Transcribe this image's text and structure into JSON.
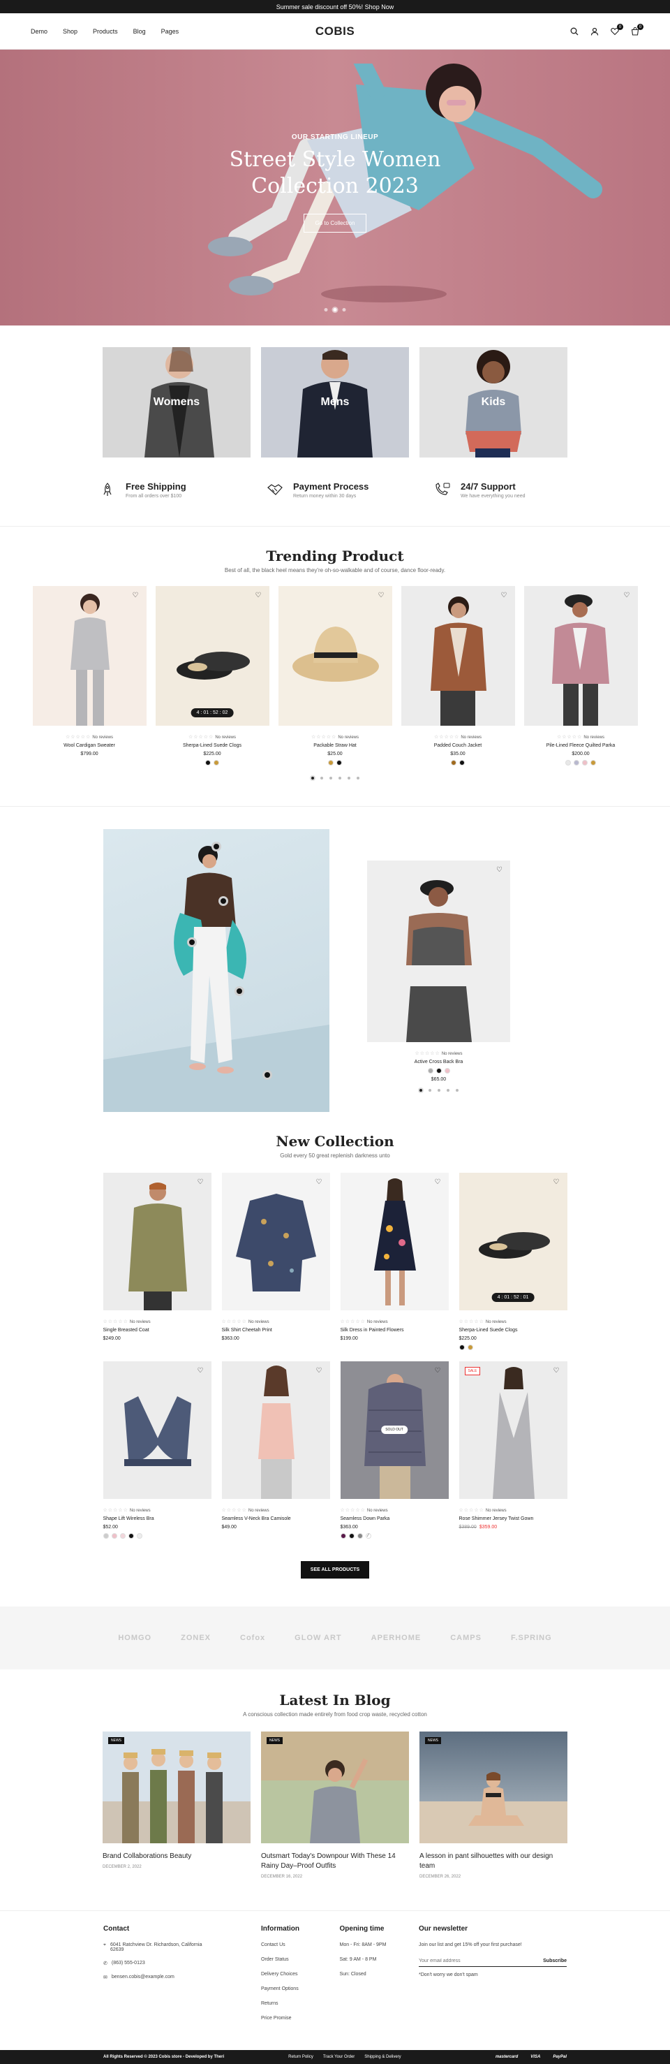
{
  "topbar": {
    "text": "Summer sale discount off 50%! Shop Now"
  },
  "header": {
    "nav": [
      "Demo",
      "Shop",
      "Products",
      "Blog",
      "Pages"
    ],
    "logo": "COBIS",
    "wishlist_count": "0",
    "cart_count": "0"
  },
  "hero": {
    "subtitle": "OUR STARTING LINEUP",
    "title_line1": "Street Style Women",
    "title_line2": "Collection 2023",
    "button": "Go to Collection"
  },
  "categories": [
    "Womens",
    "Mens",
    "Kids"
  ],
  "features": [
    {
      "title": "Free Shipping",
      "desc": "From all orders over $100"
    },
    {
      "title": "Payment Process",
      "desc": "Return money within 30 days"
    },
    {
      "title": "24/7 Support",
      "desc": "We have everything you need"
    }
  ],
  "trending": {
    "title": "Trending Product",
    "subtitle": "Best of all, the black heel means they're oh-so-walkable and of course, dance floor-ready.",
    "products": [
      {
        "name": "Wool Cardigan Sweater",
        "price": "$799.00",
        "reviews": "No reviews"
      },
      {
        "name": "Sherpa-Lined Suede Clogs",
        "price": "$225.00",
        "reviews": "No reviews",
        "timer": "4 : 01 : 52 : 02"
      },
      {
        "name": "Packable Straw Hat",
        "price": "$25.00",
        "reviews": "No reviews"
      },
      {
        "name": "Padded Couch Jacket",
        "price": "$35.00",
        "reviews": "No reviews"
      },
      {
        "name": "Pile-Lined Fleece Quilted Parka",
        "price": "$200.00",
        "reviews": "No reviews"
      }
    ]
  },
  "lookbook": {
    "product": {
      "name": "Active Cross Back Bra",
      "price": "$65.00",
      "reviews": "No reviews"
    }
  },
  "new_collection": {
    "title": "New Collection",
    "subtitle": "Gold every 50 great replenish darkness unto",
    "products": [
      {
        "name": "Single Breasted Coat",
        "price": "$249.00",
        "reviews": "No reviews"
      },
      {
        "name": "Silk Shirt Cheetah Print",
        "price": "$363.00",
        "reviews": "No reviews"
      },
      {
        "name": "Silk Dress in Painted Flowers",
        "price": "$199.00",
        "reviews": "No reviews"
      },
      {
        "name": "Sherpa-Lined Suede Clogs",
        "price": "$225.00",
        "reviews": "No reviews",
        "timer": "4 : 01 : 52 : 01"
      },
      {
        "name": "Shape Lift Wireless Bra",
        "price": "$52.00",
        "reviews": "No reviews"
      },
      {
        "name": "Seamless V-Neck Bra Camisole",
        "price": "$49.00",
        "reviews": "No reviews"
      },
      {
        "name": "Seamless Down Parka",
        "price": "$363.00",
        "reviews": "No reviews",
        "badge": "SOLD OUT"
      },
      {
        "name": "Rose Shimmer Jersey Twist Gown",
        "price": "$359.00",
        "old_price": "$389.00",
        "reviews": "No reviews",
        "badge": "SALE"
      }
    ],
    "button": "SEE ALL PRODUCTS"
  },
  "brands": [
    "HOMGO",
    "ZONEX",
    "Cofox",
    "GLOW ART",
    "APERHOME",
    "CAMPS",
    "F.SPRING"
  ],
  "blog": {
    "title": "Latest In Blog",
    "subtitle": "A conscious collection made entirely from food crop waste, recycled cotton",
    "posts": [
      {
        "tag": "NEWS",
        "title": "Brand Collaborations Beauty",
        "date": "DECEMBER 2, 2022"
      },
      {
        "tag": "NEWS",
        "title": "Outsmart Today's Downpour With These 14 Rainy Day–Proof Outfits",
        "date": "DECEMBER 16, 2022"
      },
      {
        "tag": "NEWS",
        "title": "A lesson in pant silhouettes with our design team",
        "date": "DECEMBER 26, 2022"
      }
    ]
  },
  "footer": {
    "contact": {
      "title": "Contact",
      "address": "6041 Ratchview Dr. Richardson, California 62639",
      "phone": "(863) 555-0123",
      "email": "bensen.cobis@example.com"
    },
    "information": {
      "title": "Information",
      "links": [
        "Contact Us",
        "Order Status",
        "Delivery Choices",
        "Payment Options",
        "Returns",
        "Price Promise"
      ]
    },
    "hours": {
      "title": "Opening time",
      "lines": [
        "Mon - Fri: 8AM - 9PM",
        "Sat: 9 AM - 8 PM",
        "Sun: Closed"
      ]
    },
    "newsletter": {
      "title": "Our newsletter",
      "desc": "Join our list and get 15% off your first purchase!",
      "placeholder": "Your email address",
      "button": "Subscribe",
      "note": "*Don't worry we don't spam"
    }
  },
  "bottombar": {
    "copyright": "All Rights Reserved © 2023 Cobis store - Developed by Theri",
    "links": [
      "Return Policy",
      "Track Your Order",
      "Shipping & Delivery"
    ],
    "payments": [
      "mastercard",
      "VISA",
      "PayPal"
    ]
  }
}
